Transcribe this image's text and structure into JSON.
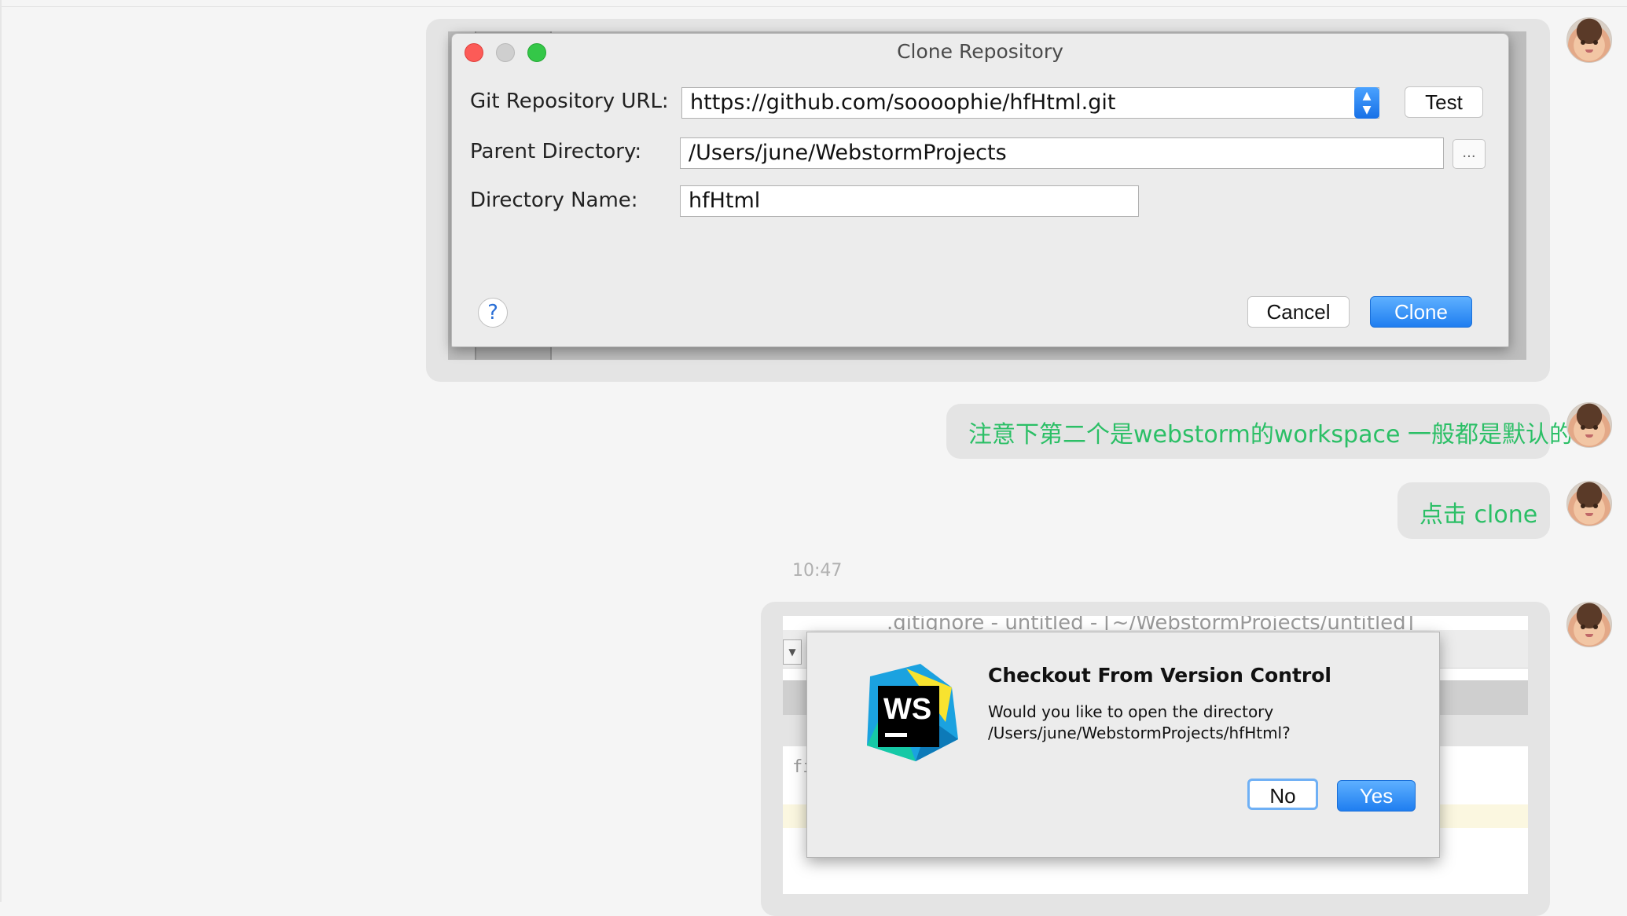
{
  "clone_dialog": {
    "title": "Clone Repository",
    "labels": {
      "url": "Git Repository URL:",
      "parent": "Parent Directory:",
      "dirname": "Directory Name:"
    },
    "url_value": "https://github.com/soooophie/hfHtml.git",
    "parent_value": "/Users/june/WebstormProjects",
    "dirname_value": "hfHtml",
    "test_button": "Test",
    "browse_button": "...",
    "help_button": "?",
    "cancel_button": "Cancel",
    "clone_button": "Clone"
  },
  "messages": [
    {
      "text": "注意下第二个是webstorm的workspace  一般都是默认的"
    },
    {
      "text": "点击 clone"
    }
  ],
  "timestamp": "10:47",
  "checkout_dialog": {
    "window_title_behind": ".gitignore - untitled - [~/WebstormProjects/untitled]",
    "code_behind": "files",
    "title": "Checkout From Version Control",
    "message_line1": "Would you like to open the directory",
    "message_line2": "/Users/june/WebstormProjects/hfHtml?",
    "no_button": "No",
    "yes_button": "Yes",
    "logo_text": "WS"
  },
  "colors": {
    "message_text": "#2bbf66",
    "bubble": "#e4e4e4",
    "primary_button": "#1f7ef0"
  }
}
